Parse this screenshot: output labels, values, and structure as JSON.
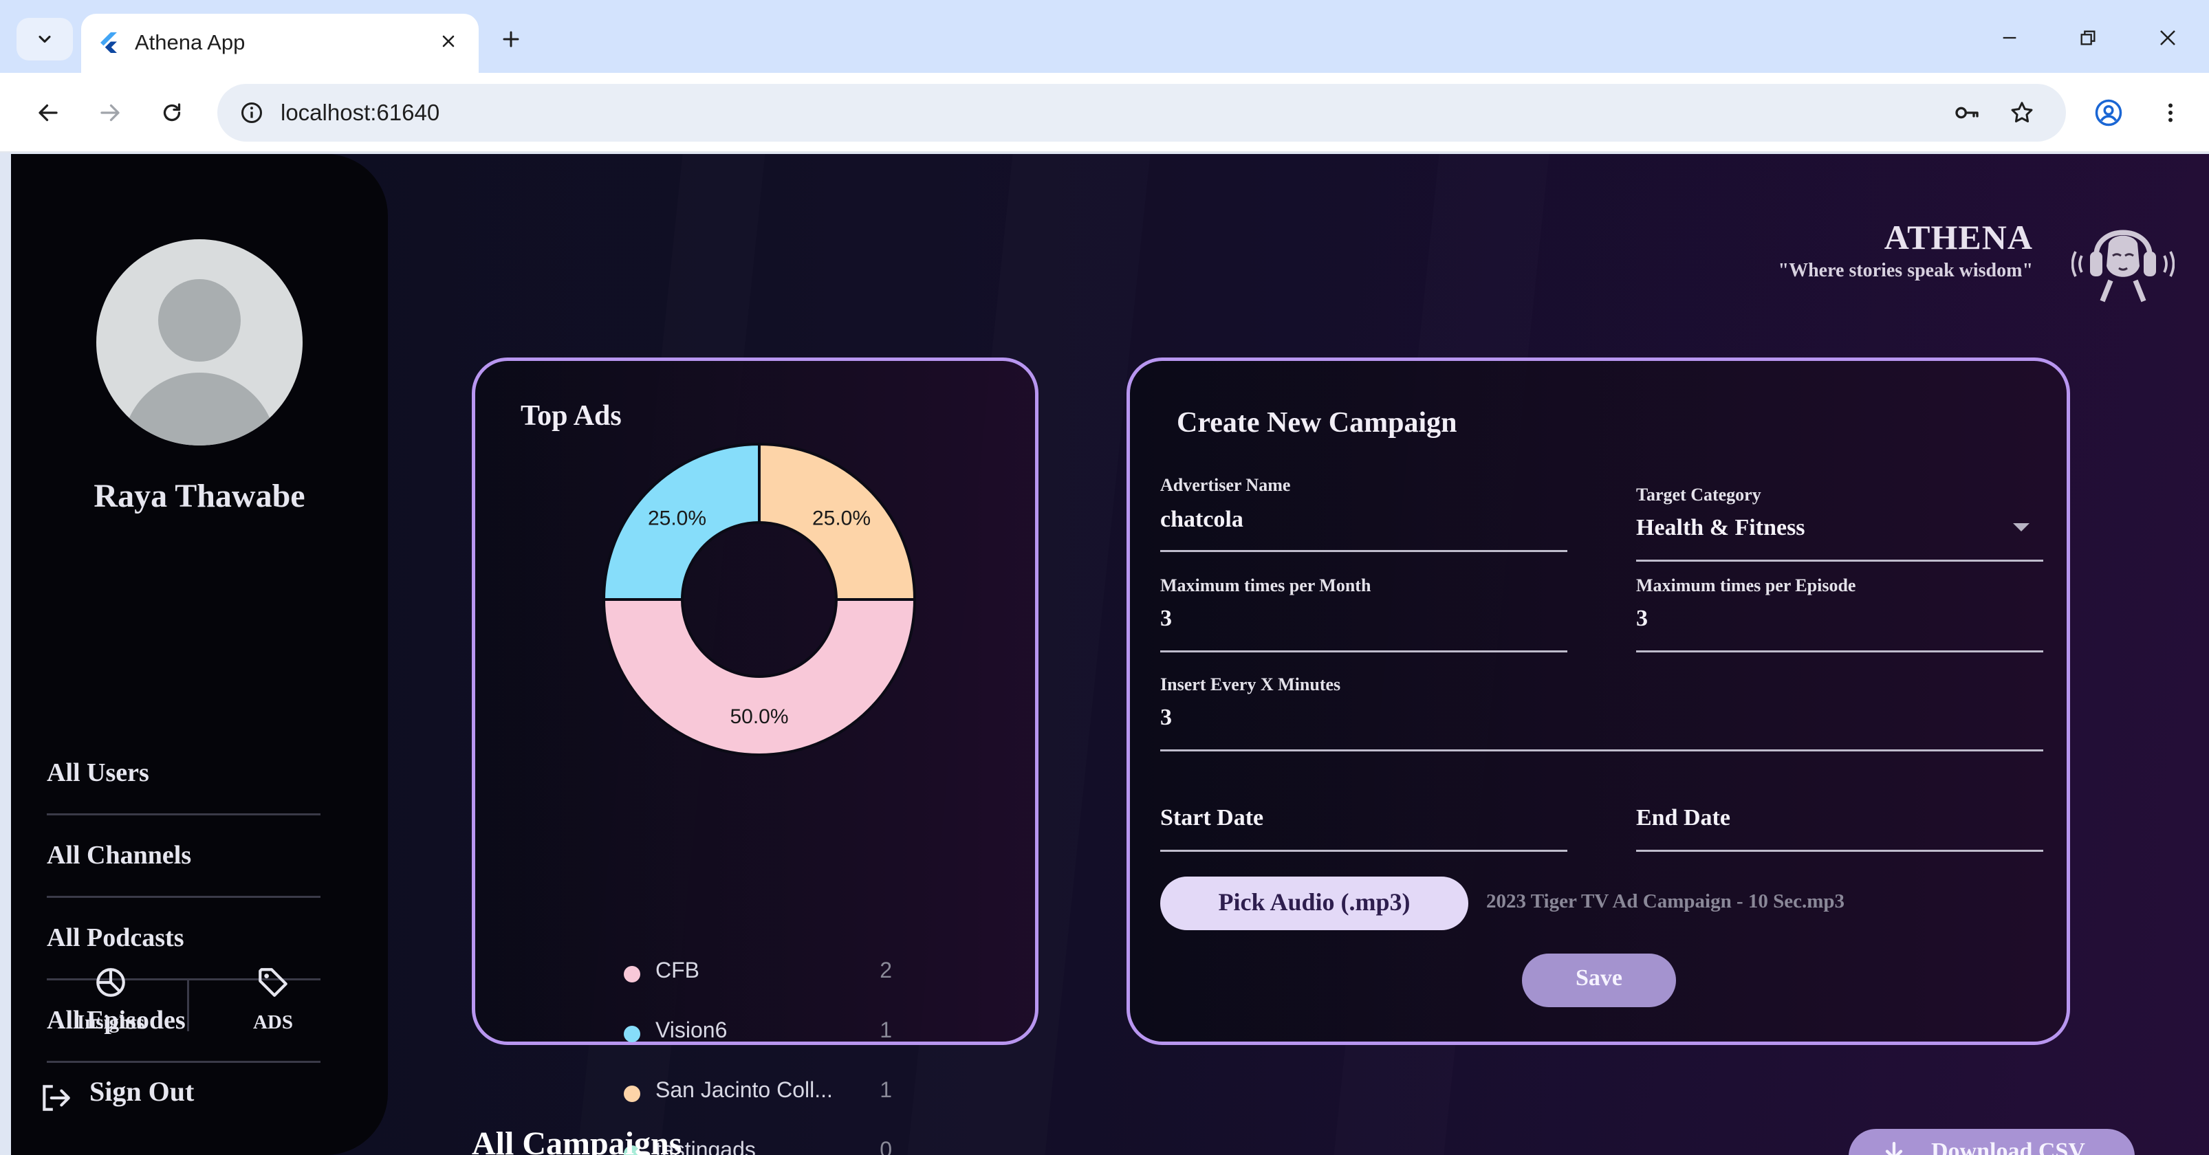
{
  "browser": {
    "tab_title": "Athena App",
    "url": "localhost:61640"
  },
  "sidebar": {
    "user_name": "Raya Thawabe",
    "nav_items": [
      {
        "label": "All Users"
      },
      {
        "label": "All Channels"
      },
      {
        "label": "All Podcasts"
      },
      {
        "label": "All Episodes"
      }
    ],
    "bottom_tabs": [
      {
        "label": "Insights",
        "icon": "pie-chart-icon"
      },
      {
        "label": "ADS",
        "icon": "tag-icon"
      }
    ],
    "sign_out_label": "Sign Out"
  },
  "brand": {
    "name": "ATHENA",
    "tagline": "\"Where stories speak wisdom\""
  },
  "top_ads": {
    "title": "Top Ads",
    "legend": [
      {
        "label": "CFB",
        "count": "2",
        "color": "#f8c8d8"
      },
      {
        "label": "Vision6",
        "count": "1",
        "color": "#86ddfa"
      },
      {
        "label": "San Jacinto Coll...",
        "count": "1",
        "color": "#fdd4a8"
      },
      {
        "label": "testingads",
        "count": "0",
        "color": "#a8ecd8"
      }
    ]
  },
  "chart_data": {
    "type": "pie",
    "title": "Top Ads",
    "categories": [
      "CFB",
      "Vision6",
      "San Jacinto Coll...",
      "testingads"
    ],
    "values": [
      2,
      1,
      1,
      0
    ],
    "slice_labels": [
      "50.0%",
      "25.0%",
      "25.0%",
      ""
    ],
    "colors": [
      "#f8c8d8",
      "#86ddfa",
      "#fdd4a8",
      "#a8ecd8"
    ],
    "donut": true,
    "legend": "bottom"
  },
  "campaign_form": {
    "title": "Create New Campaign",
    "advertiser_name_label": "Advertiser Name",
    "advertiser_name_value": "chatcola",
    "target_category_label": "Target Category",
    "target_category_value": "Health & Fitness",
    "max_month_label": "Maximum times per Month",
    "max_month_value": "3",
    "max_episode_label": "Maximum times per Episode",
    "max_episode_value": "3",
    "insert_every_label": "Insert Every X Minutes",
    "insert_every_value": "3",
    "start_date_label": "Start Date",
    "end_date_label": "End Date",
    "pick_audio_label": "Pick Audio (.mp3)",
    "audio_file_name": "2023 Tiger TV Ad Campaign - 10 Sec.mp3",
    "save_label": "Save"
  },
  "campaigns": {
    "title": "All Campaigns",
    "download_label": "Download CSV"
  },
  "colors": {
    "accent": "#b896f0",
    "button_light": "#e3d9f7",
    "button_primary": "#a493cf"
  }
}
